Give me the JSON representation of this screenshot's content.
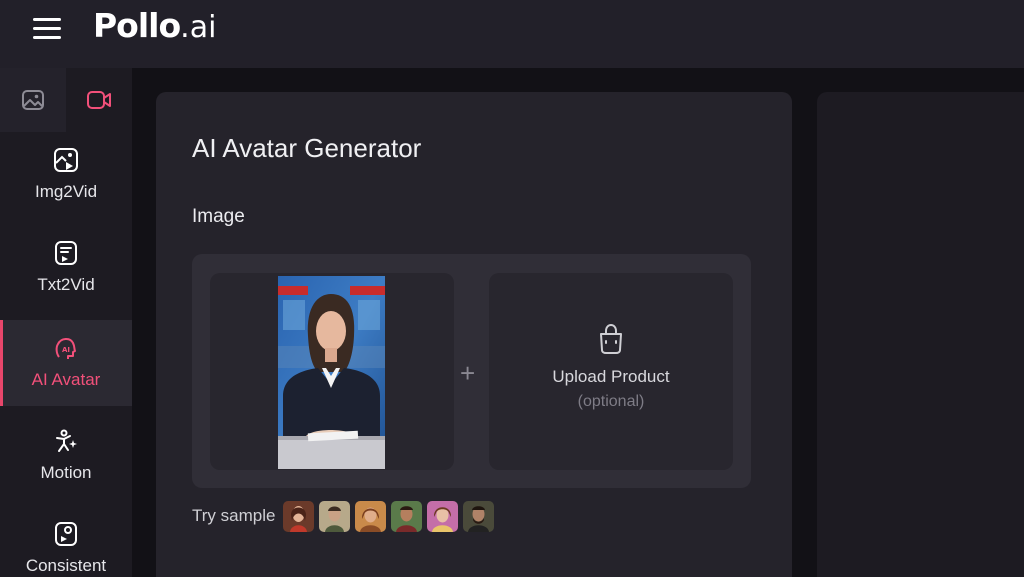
{
  "header": {
    "logo_main": "Pollo",
    "logo_suffix": ".ai",
    "menu_icon": "hamburger-menu-icon"
  },
  "sidebar": {
    "toggle": [
      {
        "icon": "image-icon",
        "active": false
      },
      {
        "icon": "video-icon",
        "active": true
      }
    ],
    "items": [
      {
        "label": "Img2Vid",
        "icon": "image-to-video-icon",
        "active": false
      },
      {
        "label": "Txt2Vid",
        "icon": "text-to-video-icon",
        "active": false
      },
      {
        "label": "AI Avatar",
        "icon": "ai-avatar-icon",
        "active": true
      },
      {
        "label": "Motion",
        "icon": "motion-icon",
        "active": false
      },
      {
        "label": "Consistent",
        "icon": "consistent-icon",
        "active": false
      }
    ]
  },
  "main": {
    "title": "AI Avatar Generator",
    "image_section_label": "Image",
    "upload_product_label": "Upload Product",
    "upload_product_optional": "(optional)",
    "try_sample_label": "Try sample"
  },
  "colors": {
    "accent": "#f2507a",
    "header_bg": "#222029",
    "panel_bg": "#25232b"
  }
}
